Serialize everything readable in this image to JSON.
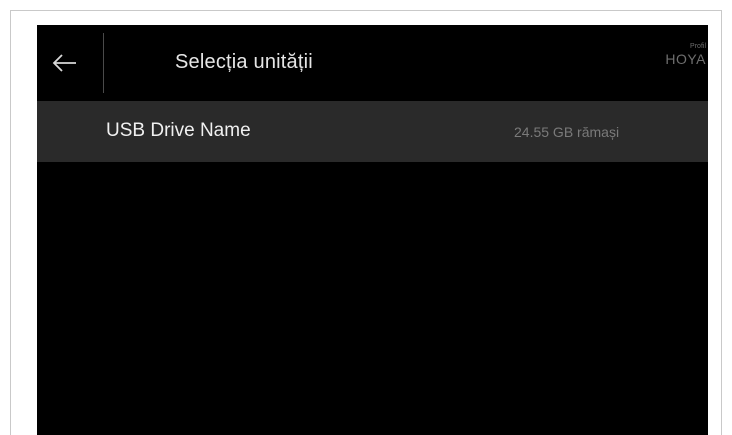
{
  "header": {
    "title": "Selecția unității",
    "back_icon": "arrow-left-icon",
    "profile": {
      "label": "Profil",
      "name": "HOYA"
    }
  },
  "drives": [
    {
      "name": "USB Drive Name",
      "space": "24.55 GB rămași"
    }
  ],
  "colors": {
    "background": "#000000",
    "row_background": "#2a2a2a",
    "primary_text": "#f0f0f0",
    "secondary_text": "#7a7a7a"
  }
}
